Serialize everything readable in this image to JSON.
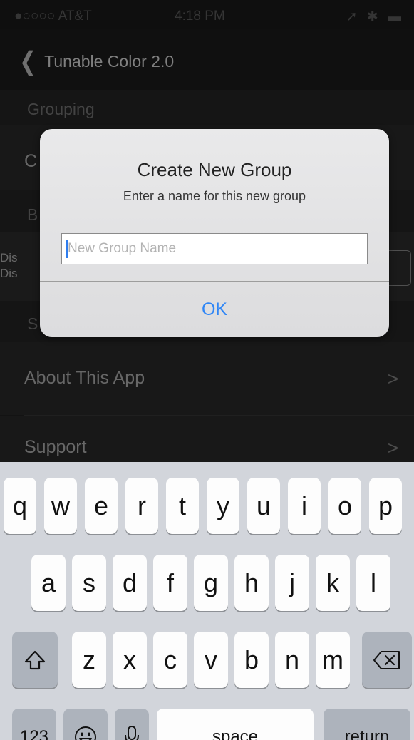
{
  "status_bar": {
    "carrier": "●○○○○ AT&T",
    "time": "4:18 PM",
    "indicators": "➚ ✱ ▬"
  },
  "nav": {
    "back_label": "Tunable Color 2.0"
  },
  "sections": {
    "grouping_header": "Grouping",
    "grouping_row_partial": "C",
    "section_b_partial": "B",
    "dis_line1": "Dis",
    "dis_line2": "Dis",
    "section_s_partial": "S"
  },
  "menu": {
    "about_label": "About This App",
    "support_label": "Support",
    "chevron": ">"
  },
  "alert": {
    "title": "Create New  Group",
    "message": "Enter a name for this  new group",
    "input_value": "",
    "input_placeholder": "New Group Name",
    "ok_label": "OK"
  },
  "keyboard": {
    "row1": [
      "q",
      "w",
      "e",
      "r",
      "t",
      "y",
      "u",
      "i",
      "o",
      "p"
    ],
    "row2": [
      "a",
      "s",
      "d",
      "f",
      "g",
      "h",
      "j",
      "k",
      "l"
    ],
    "row3": [
      "z",
      "x",
      "c",
      "v",
      "b",
      "n",
      "m"
    ],
    "numbers_label": "123",
    "space_label": "space",
    "return_label": "return",
    "icons": {
      "shift": "shift-icon",
      "delete": "delete-icon",
      "emoji": "emoji-icon",
      "mic": "microphone-icon"
    }
  },
  "colors": {
    "accent": "#2f86f6",
    "keyboard_bg": "#d2d5db",
    "function_key": "#adb3bc"
  }
}
